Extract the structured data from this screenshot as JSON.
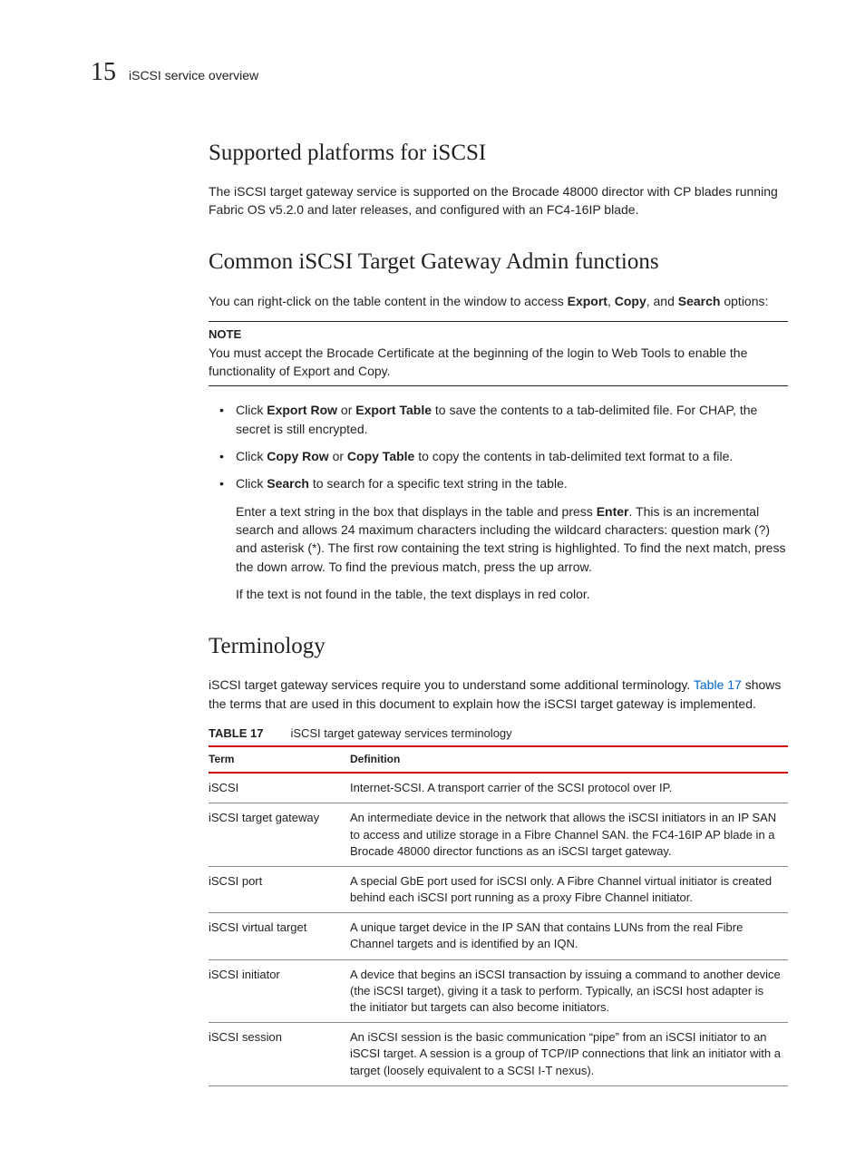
{
  "header": {
    "page_number": "15",
    "running_title": "iSCSI service overview"
  },
  "sections": {
    "supported": {
      "heading": "Supported platforms for iSCSI",
      "p1": "The iSCSI target gateway service is supported on the Brocade 48000 director with CP blades running Fabric OS v5.2.0 and later releases, and configured with an FC4-16IP blade."
    },
    "common": {
      "heading": "Common iSCSI Target Gateway Admin functions",
      "p1_a": "You can right-click on the table content in the window to access ",
      "p1_b": "Export",
      "p1_c": ", ",
      "p1_d": "Copy",
      "p1_e": ", and ",
      "p1_f": "Search",
      "p1_g": " options:",
      "note_label": "NOTE",
      "note_body": "You must accept the Brocade Certificate at the beginning of the login to Web Tools to enable the functionality of Export and Copy.",
      "b1_a": "Click ",
      "b1_b": "Export Row",
      "b1_c": " or ",
      "b1_d": "Export Table",
      "b1_e": " to save the contents to a tab-delimited file. For CHAP, the secret is still encrypted.",
      "b2_a": "Click ",
      "b2_b": "Copy Row",
      "b2_c": " or ",
      "b2_d": "Copy Table",
      "b2_e": " to copy the contents in tab-delimited text format to a file.",
      "b3_a": "Click ",
      "b3_b": "Search",
      "b3_c": " to search for a specific text string in the table.",
      "b3_sub1_a": "Enter a text string in the box that displays in the table and press ",
      "b3_sub1_b": "Enter",
      "b3_sub1_c": ". This is an incremental search and allows 24 maximum characters including the wildcard characters: question mark (?) and asterisk (*). The first row containing the text string is highlighted. To find the next match, press the down arrow. To find the previous match, press the up arrow.",
      "b3_sub2": "If the text is not found in the table, the text displays in red color."
    },
    "terminology": {
      "heading": "Terminology",
      "p1_a": "iSCSI target gateway services require you to understand some additional terminology. ",
      "p1_link": "Table 17",
      "p1_b": " shows the terms that are used in this document to explain how the iSCSI target gateway is implemented.",
      "table_label": "TABLE 17",
      "table_caption": "iSCSI target gateway services terminology",
      "th_term": "Term",
      "th_def": "Definition",
      "rows": [
        {
          "term": "iSCSI",
          "def": "Internet-SCSI. A transport carrier of the SCSI protocol over IP."
        },
        {
          "term": "iSCSI target gateway",
          "def": "An intermediate device in the network that allows the iSCSI initiators in an IP SAN to access and utilize storage in a Fibre Channel SAN. the FC4-16IP AP blade in a Brocade 48000 director functions as an iSCSI target gateway."
        },
        {
          "term": "iSCSI port",
          "def": "A special GbE port used for iSCSI only. A Fibre Channel virtual initiator is created behind each iSCSI port running as a proxy Fibre Channel initiator."
        },
        {
          "term": "iSCSI virtual target",
          "def": "A unique target device in the IP SAN that contains LUNs from the real Fibre Channel targets and is identified by an IQN."
        },
        {
          "term": "iSCSI initiator",
          "def": "A device that begins an iSCSI transaction by issuing a command to another device (the iSCSI target), giving it a task to perform. Typically, an iSCSI host adapter is the initiator but targets can also become initiators."
        },
        {
          "term": "iSCSI session",
          "def": "An iSCSI session is the basic communication “pipe” from an iSCSI initiator to an iSCSI target. A session is a group of TCP/IP connections that link an initiator with a target (loosely equivalent to a SCSI I-T nexus)."
        }
      ]
    }
  }
}
